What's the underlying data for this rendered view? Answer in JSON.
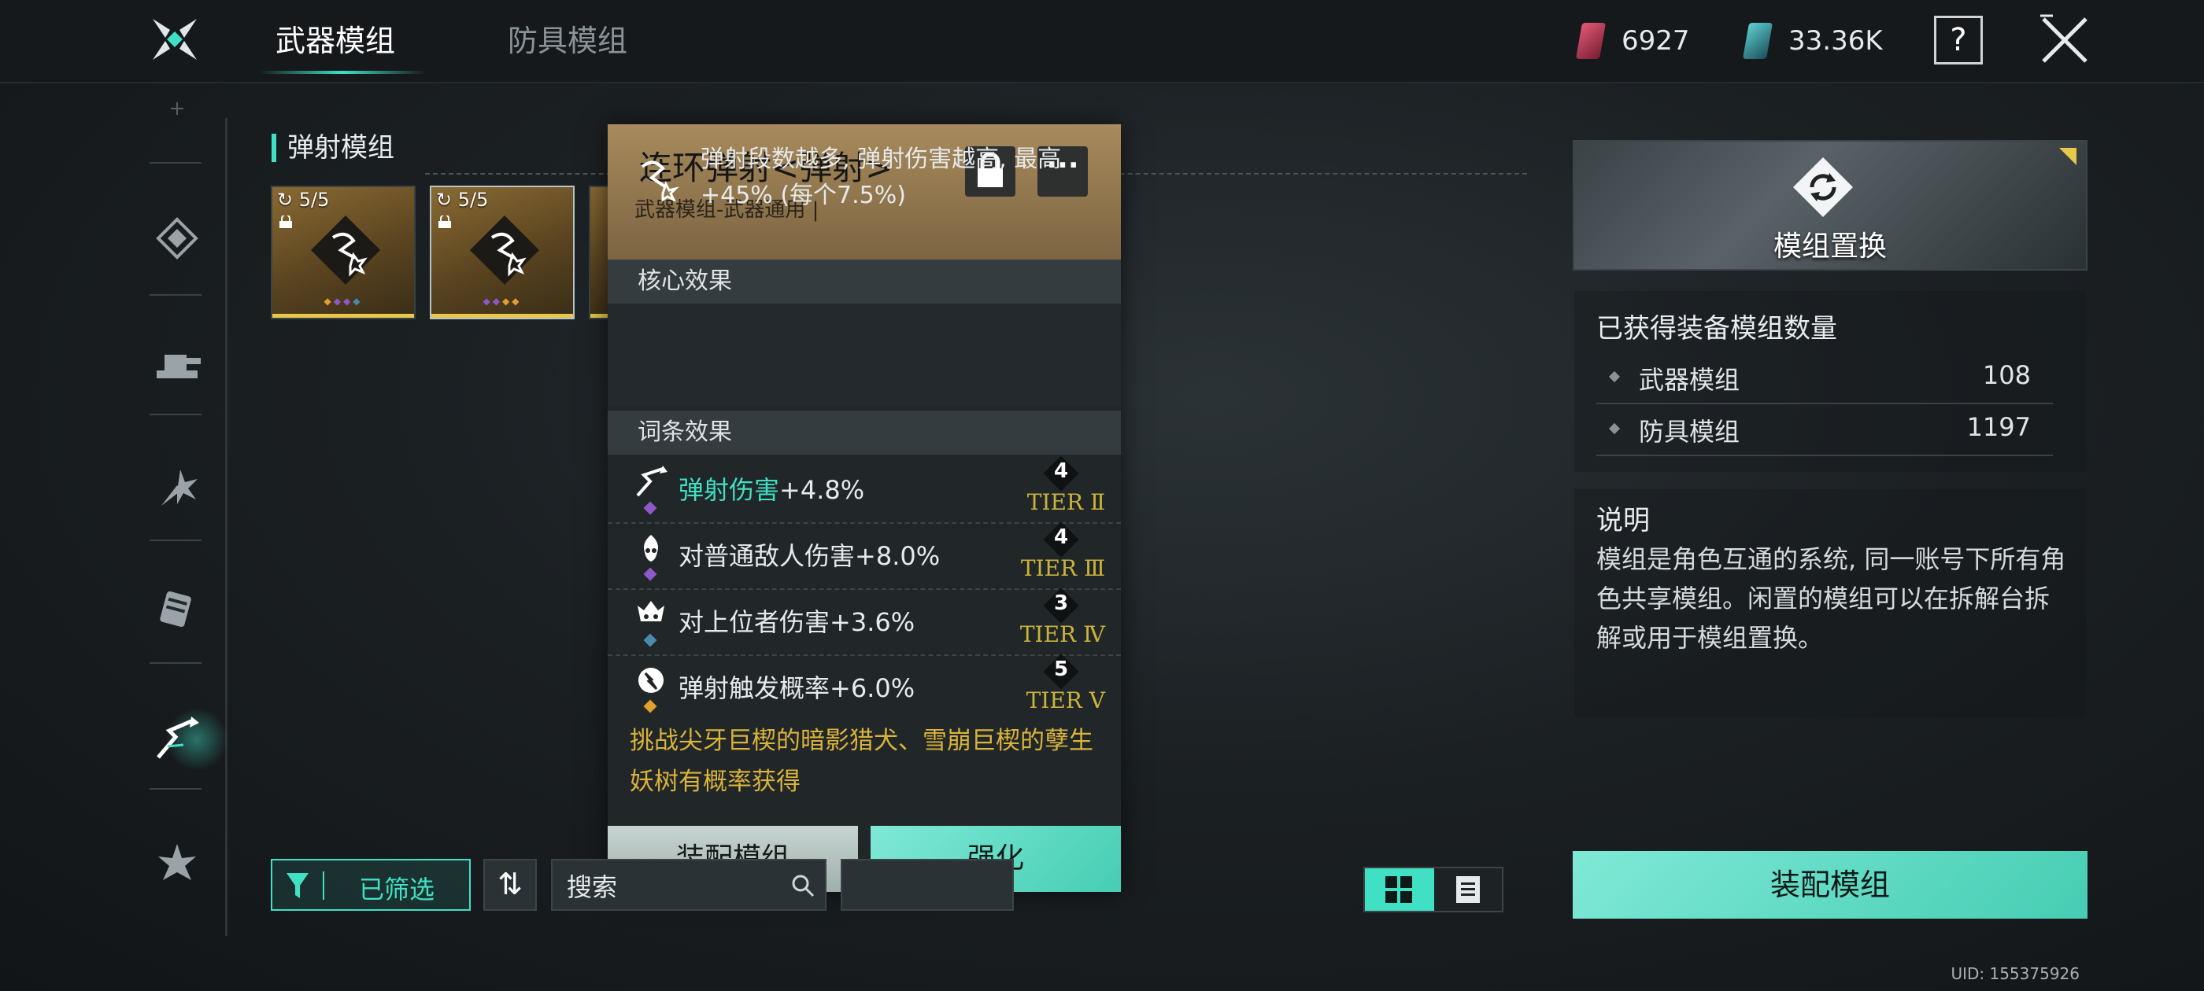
{
  "tabs": [
    {
      "label": "武器模组",
      "active": true
    },
    {
      "label": "防具模组",
      "active": false
    }
  ],
  "currencies": [
    {
      "icon": "red-crystal-icon",
      "value": "6927",
      "color": "#c23a55"
    },
    {
      "icon": "teal-crystal-icon",
      "value": "33.36K",
      "color": "#3a9a9e"
    }
  ],
  "help_label": "?",
  "section": {
    "title": "弹射模组"
  },
  "cards": [
    {
      "count": "5/5",
      "selected": true
    },
    {
      "count": "5/5",
      "selected": false
    }
  ],
  "popup": {
    "title": "连环弹射<弹射>",
    "subtitle": "武器模组-武器通用 |",
    "more_label": "···",
    "core_header": "核心效果",
    "core_text": "弹射段数越多, 弹射伤害越高, 最高+45% (每个7.5%)",
    "affix_header": "词条效果",
    "affixes": [
      {
        "icon": "ricochet-damage-icon",
        "name": "弹射伤害",
        "value": "+4.8%",
        "highlight": true,
        "level": "4",
        "tier": "TIER Ⅱ",
        "gem_color": "#8e58c8"
      },
      {
        "icon": "normal-enemy-damage-icon",
        "name": "对普通敌人伤害",
        "value": "+8.0%",
        "highlight": false,
        "level": "4",
        "tier": "TIER Ⅲ",
        "gem_color": "#8e58c8"
      },
      {
        "icon": "superior-damage-icon",
        "name": "对上位者伤害",
        "value": "+3.6%",
        "highlight": false,
        "level": "3",
        "tier": "TIER Ⅳ",
        "gem_color": "#4a8ab0"
      },
      {
        "icon": "trigger-rate-icon",
        "name": "弹射触发概率",
        "value": "+6.0%",
        "highlight": false,
        "level": "5",
        "tier": "TIER Ⅴ",
        "gem_color": "#e0a030"
      }
    ],
    "source": "挑战尖牙巨楔的暗影猎犬、雪崩巨楔的孽生妖树有概率获得",
    "equip_label": "装配模组",
    "enhance_label": "强化"
  },
  "filters": {
    "filter_label": "已筛选",
    "sort_label": "⇅",
    "search_value": "搜索"
  },
  "right_panel": {
    "banner_label": "模组置换",
    "count_title": "已获得装备模组数量",
    "counts": [
      {
        "label": "武器模组",
        "value": "108"
      },
      {
        "label": "防具模组",
        "value": "1197"
      }
    ],
    "desc_title": "说明",
    "desc_text": "模组是角色互通的系统, 同一账号下所有角色共享模组。闲置的模组可以在拆解台拆解或用于模组置换。",
    "equip_label": "装配模组"
  },
  "uid": "UID: 155375926",
  "colors": {
    "accent": "#3fe0c4",
    "gold": "#d9b33a",
    "tier": "#c9b33a"
  }
}
